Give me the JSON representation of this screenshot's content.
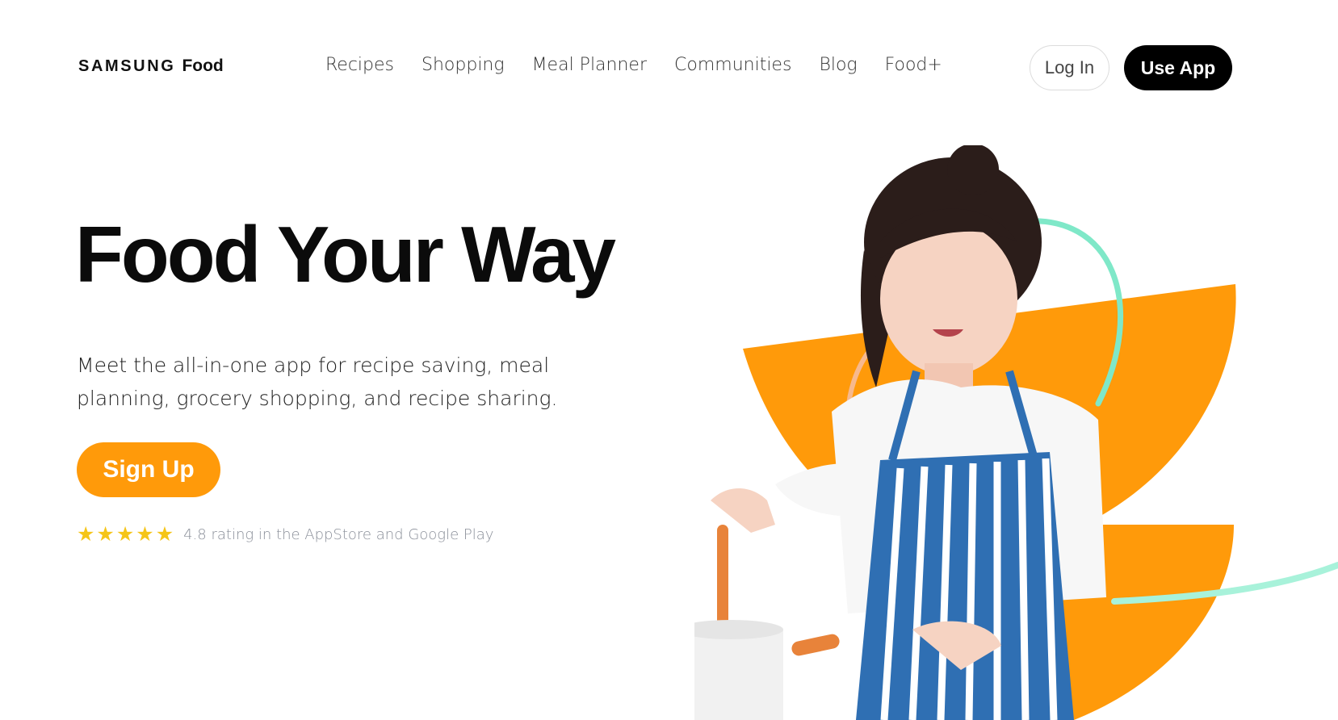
{
  "header": {
    "logo_brand": "SAMSUNG",
    "logo_product": "Food",
    "nav": [
      "Recipes",
      "Shopping",
      "Meal Planner",
      "Communities",
      "Blog",
      "Food+"
    ],
    "login_label": "Log In",
    "use_app_label": "Use App"
  },
  "hero": {
    "title": "Food Your Way",
    "subtitle": "Meet the all-in-one app for recipe saving, meal planning, grocery shopping, and recipe sharing.",
    "signup_label": "Sign Up",
    "rating_stars": 5,
    "rating_text": "4.8 rating in the AppStore and Google Play"
  },
  "colors": {
    "accent_orange": "#ff9a0a",
    "accent_mint": "#7fe8c8",
    "star_yellow": "#f5c518",
    "black": "#000000"
  },
  "icons": {
    "star": "star-icon"
  }
}
